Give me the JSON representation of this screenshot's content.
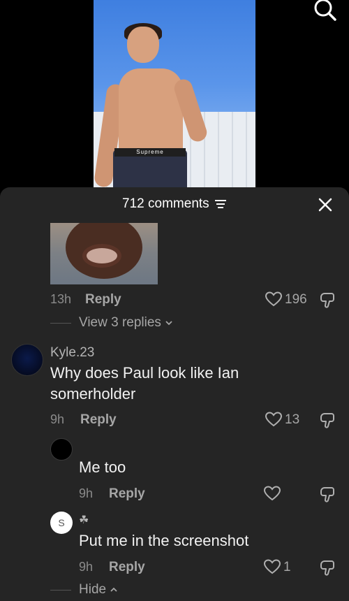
{
  "sheet": {
    "comment_count": "712 comments"
  },
  "video": {
    "waistband_text": "Supreme"
  },
  "comments": [
    {
      "time": "13h",
      "reply_label": "Reply",
      "likes": "196",
      "view_replies": "View 3 replies"
    },
    {
      "username": "Kyle.23",
      "text_line1": "Why does Paul look like Ian",
      "text_line2": "somerholder",
      "time": "9h",
      "reply_label": "Reply",
      "likes": "13"
    }
  ],
  "replies": [
    {
      "username": "",
      "text": "Me too",
      "time": "9h",
      "reply_label": "Reply",
      "likes": ""
    },
    {
      "avatar_letter": "S",
      "username": "☘",
      "text": "Put me in the screenshot",
      "time": "9h",
      "reply_label": "Reply",
      "likes": "1"
    }
  ],
  "hide_label": "Hide",
  "colors": {
    "sheet_bg": "#252525",
    "text_primary": "#f2f2f2",
    "text_secondary": "#a6a6a6"
  }
}
